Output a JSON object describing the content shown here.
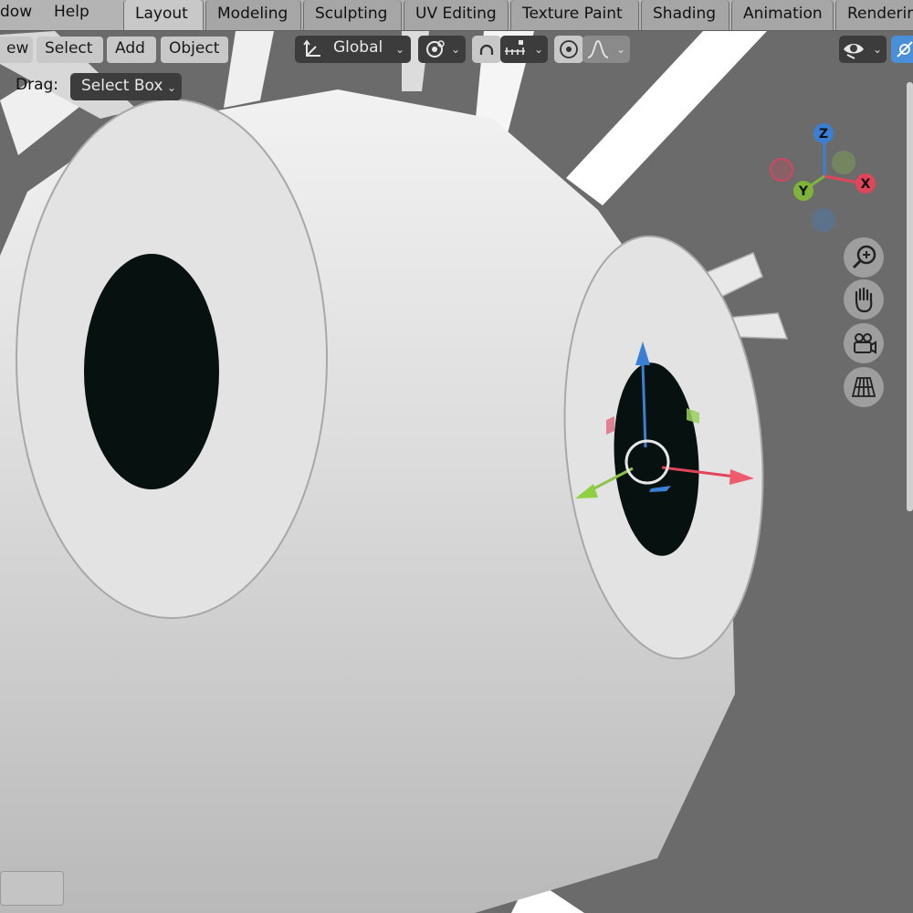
{
  "menubar": {
    "items": [
      "dow",
      "Help"
    ]
  },
  "workspaces": {
    "tabs": [
      "Layout",
      "Modeling",
      "Sculpting",
      "UV Editing",
      "Texture Paint",
      "Shading",
      "Animation",
      "Renderin"
    ],
    "active": "Layout"
  },
  "header": {
    "view_label": "ew",
    "select_label": "Select",
    "add_label": "Add",
    "object_label": "Object",
    "orientation_value": "Global",
    "drag_label": "Drag:",
    "drag_value": "Select Box"
  },
  "gizmo": {
    "z_label": "Z",
    "y_label": "Y",
    "x_label": "X",
    "x_color": "#e0455a",
    "y_color": "#7fb43a",
    "z_color": "#3b7fd4"
  },
  "nav_buttons": {
    "icons": [
      "zoom-icon",
      "hand-pan-icon",
      "camera-view-icon",
      "ortho-grid-icon"
    ]
  },
  "colors": {
    "background": "#6b6b6b",
    "accent": "#4a8fd8"
  }
}
